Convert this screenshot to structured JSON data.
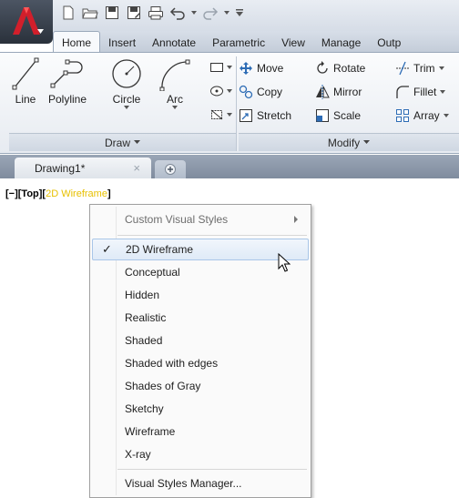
{
  "qat": {
    "icons": [
      "new-icon",
      "open-icon",
      "save-icon",
      "save-as-icon",
      "print-icon",
      "undo-icon",
      "redo-icon",
      "customize-icon"
    ]
  },
  "tabs": [
    "Home",
    "Insert",
    "Annotate",
    "Parametric",
    "View",
    "Manage",
    "Outp"
  ],
  "active_tab": "Home",
  "draw_panel": {
    "title": "Draw",
    "tools": [
      "Line",
      "Polyline",
      "Circle",
      "Arc"
    ]
  },
  "modify_panel": {
    "title": "Modify",
    "rows": [
      [
        "Move",
        "Rotate",
        "Trim"
      ],
      [
        "Copy",
        "Mirror",
        "Fillet"
      ],
      [
        "Stretch",
        "Scale",
        "Array"
      ]
    ]
  },
  "document_tab": {
    "name": "Drawing1*",
    "close": "×"
  },
  "viewport_controls": {
    "prefix": "[−][Top][",
    "style": "2D Wireframe",
    "suffix": "]"
  },
  "visual_styles_menu": {
    "header": "Custom Visual Styles",
    "items": [
      "2D Wireframe",
      "Conceptual",
      "Hidden",
      "Realistic",
      "Shaded",
      "Shaded with edges",
      "Shades of Gray",
      "Sketchy",
      "Wireframe",
      "X-ray"
    ],
    "selected": "2D Wireframe",
    "check": "✓",
    "footer": "Visual Styles Manager..."
  },
  "colors": {
    "accent_red": "#c8102e",
    "highlight_yellow": "#e7c000",
    "menu_selection_border": "#a9c6e8"
  }
}
